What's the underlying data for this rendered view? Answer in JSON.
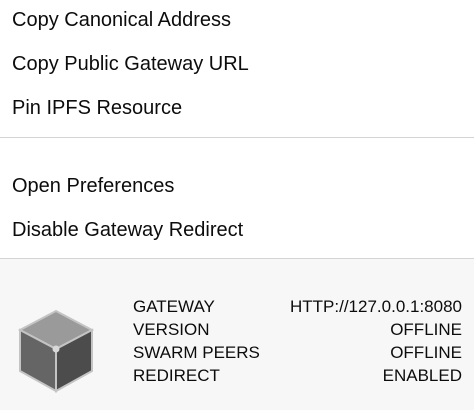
{
  "menu": {
    "group1": [
      {
        "label": "Copy Canonical Address"
      },
      {
        "label": "Copy Public Gateway URL"
      },
      {
        "label": "Pin IPFS Resource"
      }
    ],
    "group2": [
      {
        "label": "Open Preferences"
      },
      {
        "label": "Disable Gateway Redirect"
      }
    ]
  },
  "status": {
    "icon": "ipfs-cube-icon",
    "rows": [
      {
        "label": "GATEWAY",
        "value": "HTTP://127.0.0.1:8080"
      },
      {
        "label": "VERSION",
        "value": "OFFLINE"
      },
      {
        "label": "SWARM PEERS",
        "value": "OFFLINE"
      },
      {
        "label": "REDIRECT",
        "value": "ENABLED"
      }
    ]
  }
}
